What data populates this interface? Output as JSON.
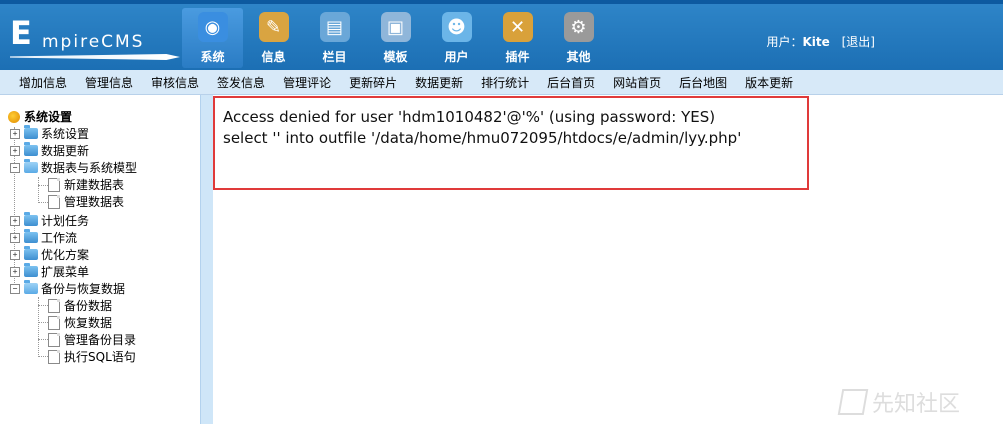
{
  "header": {
    "logo_text_E": "E",
    "logo_text_rest": "mpireCMS",
    "nav": [
      {
        "label": "系统",
        "icon": "globe-icon",
        "glyph": "◉",
        "color": "#3a8ee0",
        "active": true
      },
      {
        "label": "信息",
        "icon": "notepad-icon",
        "glyph": "✎",
        "color": "#d9a441"
      },
      {
        "label": "栏目",
        "icon": "folder-icon",
        "glyph": "▤",
        "color": "#6aa7d8"
      },
      {
        "label": "模板",
        "icon": "window-icon",
        "glyph": "▣",
        "color": "#8fb6da"
      },
      {
        "label": "用户",
        "icon": "user-icon",
        "glyph": "☻",
        "color": "#6bb5e8"
      },
      {
        "label": "插件",
        "icon": "tools-icon",
        "glyph": "✕",
        "color": "#d9a13a"
      },
      {
        "label": "其他",
        "icon": "gear-icon",
        "glyph": "⚙",
        "color": "#9a9a9a"
      }
    ],
    "user_label": "用户：",
    "user_name": "Kite",
    "logout": "[退出]"
  },
  "submenu": [
    "增加信息",
    "管理信息",
    "审核信息",
    "签发信息",
    "管理评论",
    "更新碎片",
    "数据更新",
    "排行统计",
    "后台首页",
    "网站首页",
    "后台地图",
    "版本更新"
  ],
  "sidebar": {
    "root": "系统设置",
    "nodes": {
      "n0": "系统设置",
      "n1": "数据更新",
      "n2": "数据表与系统模型",
      "n2a": "新建数据表",
      "n2b": "管理数据表",
      "n3": "计划任务",
      "n4": "工作流",
      "n5": "优化方案",
      "n6": "扩展菜单",
      "n7": "备份与恢复数据",
      "n7a": "备份数据",
      "n7b": "恢复数据",
      "n7c": "管理备份目录",
      "n7d": "执行SQL语句"
    }
  },
  "content": {
    "error_line1": "Access denied for user 'hdm1010482'@'%' (using password: YES)",
    "error_line2": "select '' into outfile '/data/home/hmu072095/htdocs/e/admin/lyy.php'"
  },
  "watermark": "先知社区"
}
